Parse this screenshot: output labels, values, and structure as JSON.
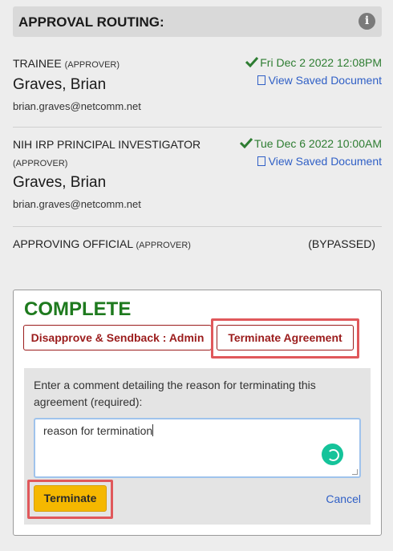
{
  "header": {
    "title": "APPROVAL ROUTING:",
    "info_icon": "i"
  },
  "approvers": [
    {
      "role": "TRAINEE",
      "role_tag": "(APPROVER)",
      "name": "Graves, Brian",
      "email": "brian.graves@netcomm.net",
      "date": "Fri Dec 2 2022 12:08PM",
      "doc_link": "View Saved Document"
    },
    {
      "role": "NIH IRP PRINCIPAL INVESTIGATOR",
      "role_tag": "(APPROVER)",
      "name": "Graves, Brian",
      "email": "brian.graves@netcomm.net",
      "date": "Tue Dec 6 2022 10:00AM",
      "doc_link": "View Saved Document"
    },
    {
      "role": "APPROVING OFFICIAL",
      "role_tag": "(APPROVER)",
      "status": "(BYPASSED)"
    }
  ],
  "action_panel": {
    "title": "COMPLETE",
    "disapprove_label": "Disapprove & Sendback : Admin",
    "terminate_agreement_label": "Terminate Agreement",
    "prompt": "Enter a comment detailing the reason for terminating this agreement (required):",
    "comment_value": "reason for termination",
    "terminate_label": "Terminate",
    "cancel_label": "Cancel"
  },
  "colors": {
    "success": "#2e7d32",
    "danger": "#9b1c1c",
    "primary_button": "#f5b800",
    "link": "#2f5fc6",
    "highlight": "#e0585b"
  }
}
